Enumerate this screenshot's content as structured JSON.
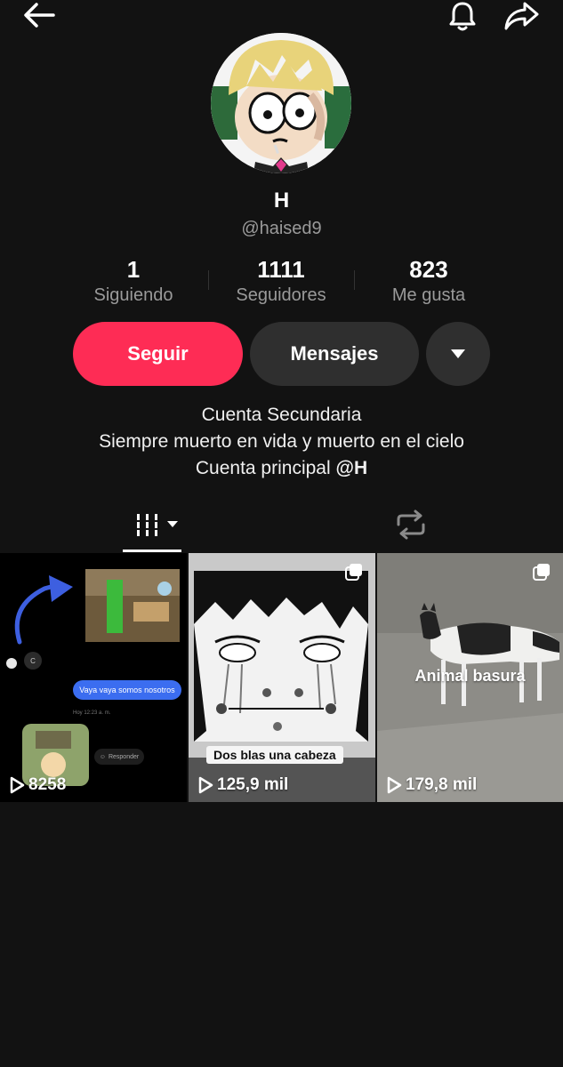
{
  "topbar": {
    "back_icon": "arrow-left-icon",
    "bell_icon": "bell-icon",
    "share_icon": "share-icon"
  },
  "profile": {
    "name": "H",
    "handle": "@haised9",
    "stats": [
      {
        "value": "1",
        "label": "Siguiendo"
      },
      {
        "value": "1111",
        "label": "Seguidores"
      },
      {
        "value": "823",
        "label": "Me gusta"
      }
    ]
  },
  "actions": {
    "follow_label": "Seguir",
    "message_label": "Mensajes",
    "more_icon": "caret-down-icon"
  },
  "bio": {
    "line1": "Cuenta Secundaria",
    "line2": "Siempre muerto en vida y muerto en el cielo",
    "line3_prefix": "Cuenta principal ",
    "line3_mention": "@H"
  },
  "tabs": {
    "videos_icon": "videos-grid-icon",
    "reposts_icon": "repost-icon"
  },
  "videos": [
    {
      "views": "8258",
      "chat_message": "Vaya vaya somos nosotros",
      "chat_time": "Hoy 12:23 a. m.",
      "reply_label": "Responder",
      "contact_initial": "C"
    },
    {
      "views": "125,9 mil",
      "caption": "Dos blas una cabeza"
    },
    {
      "views": "179,8 mil",
      "caption": "Animal basura"
    }
  ],
  "colors": {
    "background": "#121212",
    "follow_button": "#fe2c55",
    "secondary_button": "#2f2f2f",
    "muted_text": "#9a9a9a"
  }
}
